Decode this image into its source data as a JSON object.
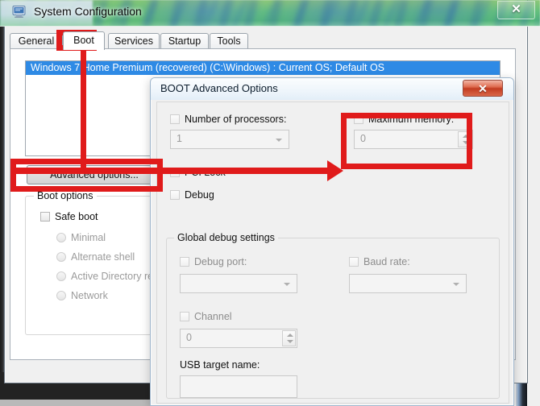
{
  "window": {
    "title": "System Configuration",
    "icon": "system-configuration-icon",
    "close_label": "✕"
  },
  "tabs": [
    {
      "label": "General",
      "active": false
    },
    {
      "label": "Boot",
      "active": true
    },
    {
      "label": "Services",
      "active": false
    },
    {
      "label": "Startup",
      "active": false
    },
    {
      "label": "Tools",
      "active": false
    }
  ],
  "boot_tab": {
    "os_entry": "Windows 7 Home Premium (recovered)  (C:\\Windows) : Current OS; Default OS",
    "advanced_button": "Advanced options...",
    "boot_options_legend": "Boot options",
    "safe_boot_label": "Safe boot",
    "safe_boot_checked": false,
    "radios": [
      {
        "label": "Minimal",
        "selected": false
      },
      {
        "label": "Alternate shell",
        "selected": false
      },
      {
        "label": "Active Directory re",
        "selected": false
      },
      {
        "label": "Network",
        "selected": false
      }
    ]
  },
  "dialog": {
    "title": "BOOT Advanced Options",
    "close_label": "✕",
    "number_of_processors": {
      "label": "Number of processors:",
      "checked": false,
      "value": "1"
    },
    "maximum_memory": {
      "label": "Maximum memory:",
      "checked": false,
      "value": "0"
    },
    "pci_lock": {
      "label": "PCI Lock",
      "checked": false
    },
    "debug": {
      "label": "Debug",
      "checked": false
    },
    "global_debug": {
      "legend": "Global debug settings",
      "debug_port": {
        "label": "Debug port:",
        "checked": false,
        "value": ""
      },
      "baud_rate": {
        "label": "Baud rate:",
        "checked": false,
        "value": ""
      },
      "channel": {
        "label": "Channel",
        "checked": false,
        "value": "0"
      },
      "usb_target_name": {
        "label": "USB target name:",
        "value": ""
      }
    }
  },
  "annotations": {
    "color": "#e01b1b",
    "highlight_tab": "Boot",
    "highlight_button": "Advanced options...",
    "highlight_field": "Maximum memory:"
  }
}
